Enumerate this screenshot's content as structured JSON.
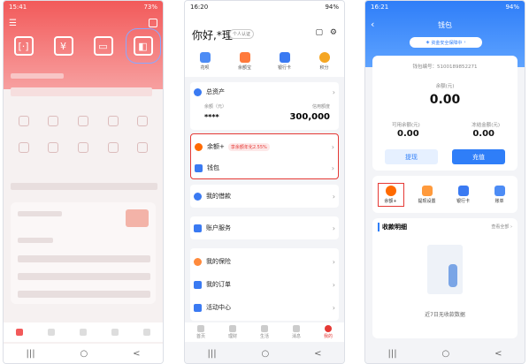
{
  "phone1": {
    "status": {
      "time": "15:41",
      "battery": "73%"
    },
    "nav": [
      "|||",
      "○",
      "<"
    ]
  },
  "phone2": {
    "status": {
      "time": "16:20",
      "battery": "94%"
    },
    "greeting": "你好,*理",
    "greeting_badge": "个人认证",
    "quick_icons": [
      "花呗",
      "余额宝",
      "银行卡",
      "积分"
    ],
    "total_assets": {
      "label": "总资产",
      "balance_label": "余额（元）",
      "balance_value": "****",
      "credit_label": "信用额度",
      "credit_value": "300,000"
    },
    "rows": [
      {
        "label": "余额+",
        "tag": "享余额年化2.55%"
      },
      {
        "label": "钱包"
      },
      {
        "label": "我的借款"
      },
      {
        "label": "账户服务"
      },
      {
        "label": "我的保险"
      },
      {
        "label": "我的订单"
      },
      {
        "label": "活动中心"
      }
    ],
    "tabs": [
      "首页",
      "理财",
      "生活",
      "消息",
      "我的"
    ],
    "nav": [
      "|||",
      "○",
      "<"
    ]
  },
  "phone3": {
    "status": {
      "time": "16:21",
      "battery": "94%"
    },
    "title": "钱包",
    "security_pill": "资金安全保障中",
    "wallet_no": "钱包编号：5100189852271",
    "balance_label": "余额(元)",
    "balance_value": "0.00",
    "available_label": "可用余额(元)",
    "available_value": "0.00",
    "frozen_label": "冻结金额(元)",
    "frozen_value": "0.00",
    "withdraw": "提现",
    "recharge": "充值",
    "grid": [
      "余额+",
      "提现设置",
      "银行卡",
      "账单"
    ],
    "detail_title": "收款明细",
    "detail_more": "查看全部",
    "empty_text": "近7日无收款数据",
    "nav": [
      "|||",
      "○",
      "<"
    ]
  },
  "colors": {
    "red": "#f25a5a",
    "blue": "#2f7ef8",
    "orange": "#ff6a00"
  }
}
